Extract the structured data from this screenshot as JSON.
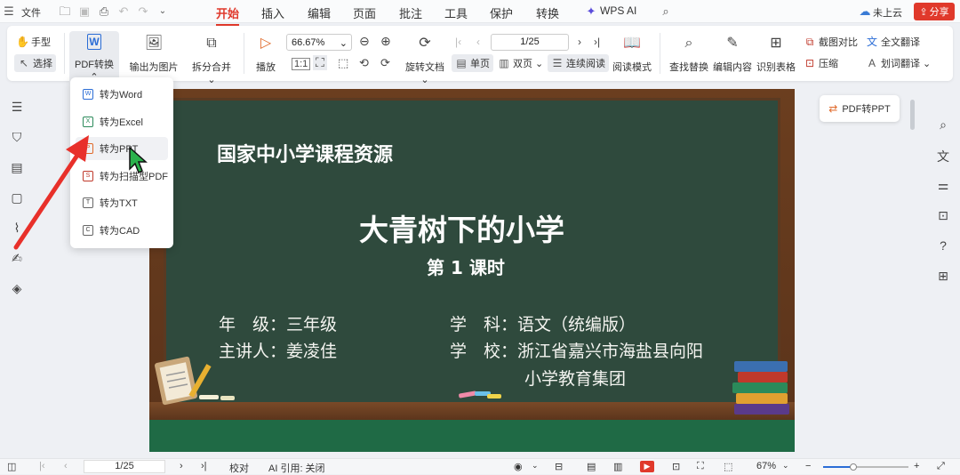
{
  "topbar": {
    "file_label": "文件",
    "tabs": [
      {
        "label": "开始",
        "active": true
      },
      {
        "label": "插入"
      },
      {
        "label": "编辑"
      },
      {
        "label": "页面"
      },
      {
        "label": "批注"
      },
      {
        "label": "工具"
      },
      {
        "label": "保护"
      },
      {
        "label": "转换"
      }
    ],
    "wps_ai": "WPS AI",
    "cloud_status": "未上云",
    "share_label": "分享"
  },
  "ribbon": {
    "hand_tool": "手型",
    "select_tool": "选择",
    "pdf_convert": "PDF转换",
    "export_image": "输出为图片",
    "split_merge": "拆分合并",
    "play": "播放",
    "zoom_value": "66.67%",
    "page_value": "1/25",
    "rotate_doc": "旋转文档",
    "single_page": "单页",
    "double_page": "双页",
    "continuous": "连续阅读",
    "read_mode": "阅读模式",
    "find_replace": "查找替换",
    "edit_content": "编辑内容",
    "recognize_table": "识别表格",
    "screenshot_compare": "截图对比",
    "compress": "压缩",
    "full_translate": "全文翻译",
    "word_translate": "划词翻译"
  },
  "dropdown": {
    "items": [
      {
        "label": "转为Word",
        "icon": "W"
      },
      {
        "label": "转为Excel",
        "icon": "X"
      },
      {
        "label": "转为PPT",
        "icon": "P"
      },
      {
        "label": "转为扫描型PDF",
        "icon": "S"
      },
      {
        "label": "转为TXT",
        "icon": "T"
      },
      {
        "label": "转为CAD",
        "icon": "C"
      }
    ]
  },
  "pdf_to_ppt_button": "PDF转PPT",
  "slide": {
    "org": "国家中小学课程资源",
    "title": "大青树下的小学",
    "lesson": "第 1 课时",
    "grade_label": "年　级：三年级",
    "subject_label": "学　科：语文（统编版）",
    "teacher_label": "主讲人：姜凌佳",
    "school_label": "学　校：浙江省嘉兴市海盐县向阳",
    "school_line2": "小学教育集团"
  },
  "statusbar": {
    "page": "1/25",
    "proofread": "校对",
    "ai_quote": "AI 引用: 关闭",
    "zoom": "67%"
  },
  "colors": {
    "accent": "#e0392b",
    "board": "#2f4a3d",
    "arrow": "#e8302a"
  }
}
